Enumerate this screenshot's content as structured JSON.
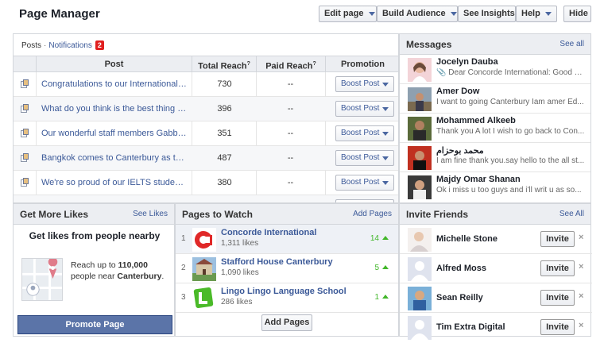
{
  "header": {
    "title": "Page Manager",
    "edit_page": "Edit page",
    "build_audience": "Build Audience",
    "see_insights": "See Insights",
    "help": "Help",
    "hide": "Hide"
  },
  "posts": {
    "tab_posts": "Posts",
    "tab_sep": "·",
    "tab_notifications": "Notifications",
    "notif_count": "2",
    "columns": {
      "post": "Post",
      "total_reach": "Total Reach",
      "paid_reach": "Paid Reach",
      "promotion": "Promotion",
      "sup": "?"
    },
    "rows": [
      {
        "text": "Congratulations to our International Fo...",
        "reach": "730",
        "paid": "--",
        "boost": "Boost Post"
      },
      {
        "text": "What do you think is the best thing ab...",
        "reach": "396",
        "paid": "--",
        "boost": "Boost Post"
      },
      {
        "text": "Our wonderful staff members Gabbi (It...",
        "reach": "351",
        "paid": "--",
        "boost": "Boost Post"
      },
      {
        "text": "Bangkok comes to Canterbury as the l...",
        "reach": "487",
        "paid": "--",
        "boost": "Boost Post"
      },
      {
        "text": "We're so proud of our IELTS students...",
        "reach": "380",
        "paid": "--",
        "boost": "Boost Post"
      }
    ]
  },
  "messages": {
    "title": "Messages",
    "see_all": "See all",
    "items": [
      {
        "name": "Jocelyn Dauba",
        "snippet": "📎 Dear Concorde International: Good Da..."
      },
      {
        "name": "Amer Dow",
        "snippet": "I want to going Canterbury Iam amer Ed..."
      },
      {
        "name": "Mohammed Alkeeb",
        "snippet": "Thank you A lot I wish to go back to Con..."
      },
      {
        "name": "محمد بوحزام",
        "snippet": "I am fine thank you.say hello to the all st..."
      },
      {
        "name": "Majdy Omar Shanan",
        "snippet": "Ok i miss u too guys and i'll writ u as so..."
      }
    ]
  },
  "get_likes": {
    "title": "Get More Likes",
    "see_likes": "See Likes",
    "headline": "Get likes from people nearby",
    "reach_prefix": "Reach up to ",
    "reach_number": "110,000",
    "reach_middle": " people near ",
    "reach_place": "Canterbury",
    "reach_suffix": ".",
    "promote": "Promote Page"
  },
  "pages_to_watch": {
    "title": "Pages to Watch",
    "add_link": "Add Pages",
    "add_button": "Add Pages",
    "items": [
      {
        "num": "1",
        "name": "Concorde International",
        "likes": "1,311 likes",
        "count": "14"
      },
      {
        "num": "2",
        "name": "Stafford House Canterbury",
        "likes": "1,090 likes",
        "count": "5"
      },
      {
        "num": "3",
        "name": "Lingo Lingo Language School",
        "likes": "286 likes",
        "count": "1"
      }
    ]
  },
  "invite": {
    "title": "Invite Friends",
    "see_all": "See All",
    "button": "Invite",
    "close": "×",
    "friends": [
      {
        "name": "Michelle Stone"
      },
      {
        "name": "Alfred Moss"
      },
      {
        "name": "Sean Reilly"
      },
      {
        "name": "Tim Extra Digital"
      }
    ]
  },
  "colors": {
    "link": "#3b5998",
    "accent_green": "#42b72a",
    "promote_bg": "#5b74a8"
  }
}
